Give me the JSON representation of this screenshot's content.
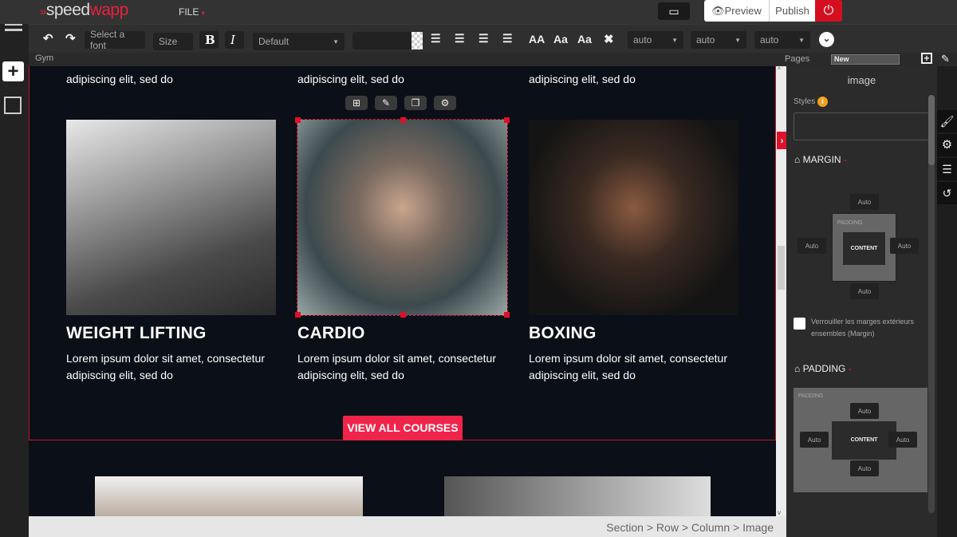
{
  "app": {
    "logo_a": "speed",
    "logo_b": "wapp",
    "file_menu": "FILE",
    "preview": "Preview",
    "publish": "Publish"
  },
  "toolbar": {
    "font": "Select a font",
    "size": "Size",
    "bold": "B",
    "italic": "I",
    "style": "Default",
    "case1": "AA",
    "case2": "Aa",
    "case3": "Aa",
    "sel1": "auto",
    "sel2": "auto",
    "sel3": "auto"
  },
  "path": {
    "page": "Gym",
    "pages_label": "Pages",
    "pages_value": "New"
  },
  "canvas": {
    "top_texts": [
      "adipiscing elit, sed do",
      "adipiscing elit, sed do",
      "adipiscing elit, sed do"
    ],
    "cards": [
      {
        "title": "WEIGHT LIFTING",
        "text": "Lorem ipsum dolor sit amet, consectetur adipiscing elit, sed do"
      },
      {
        "title": "CARDIO",
        "text": "Lorem ipsum dolor sit amet, consectetur adipiscing elit, sed do"
      },
      {
        "title": "BOXING",
        "text": "Lorem ipsum dolor sit amet, consectetur adipiscing elit, sed do"
      }
    ],
    "button": "VIEW ALL COURSES"
  },
  "panel": {
    "title": "image",
    "styles": "Styles",
    "margin": "MARGIN",
    "padding": "PADDING",
    "padding_inner": "PADDING",
    "content": "CONTENT",
    "auto": "Auto",
    "lock": "Verrouiller les marges extérieurs ensembles (Margin)"
  },
  "breadcrumb": "Section > Row > Column > Image",
  "colors": {
    "accent": "#e8213f",
    "canvas": "#0b0f17"
  }
}
